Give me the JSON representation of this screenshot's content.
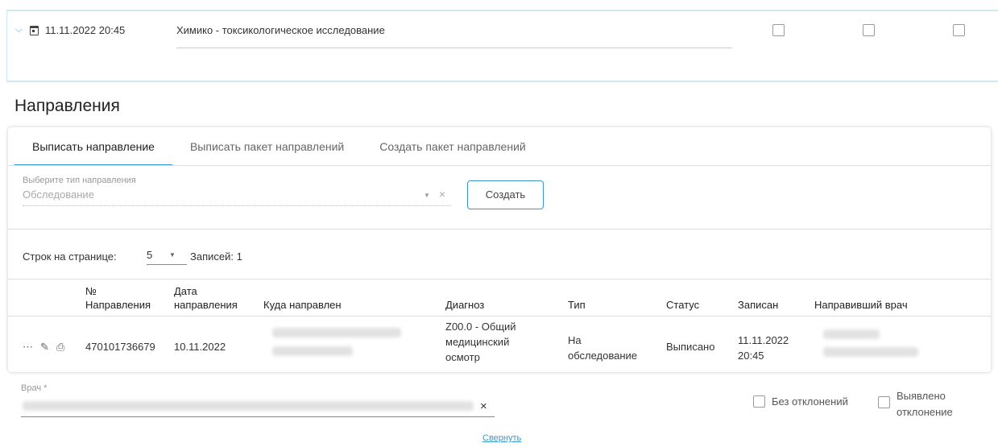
{
  "record": {
    "date": "11.11.2022 20:45",
    "name": "Химико - токсикологическое исследование"
  },
  "section_title": "Направления",
  "tabs": [
    {
      "label": "Выписать направление"
    },
    {
      "label": "Выписать пакет направлений"
    },
    {
      "label": "Создать пакет направлений"
    }
  ],
  "type_select": {
    "label": "Выберите тип направления",
    "value": "Обследование"
  },
  "create_button": "Создать",
  "pagination": {
    "rows_label": "Строк на странице:",
    "rows_value": "5",
    "records_label": "Записей: 1"
  },
  "table": {
    "headers": {
      "number": "№\nНаправления",
      "date": "Дата\nнаправления",
      "destination": "Куда направлен",
      "diagnosis": "Диагноз",
      "type": "Тип",
      "status": "Статус",
      "booked": "Записан",
      "doctor": "Направивший врач"
    },
    "row": {
      "number": "470101736679",
      "date": "10.11.2022",
      "diagnosis": "Z00.0 - Общий\nмедицинский\nосмотр",
      "type": "На\nобследование",
      "status": "Выписано",
      "booked": "11.11.2022\n20:45"
    }
  },
  "doctor_field": {
    "label": "Врач *"
  },
  "options": {
    "no_deviation": "Без отклонений",
    "deviation": "Выявлено\nотклонение"
  },
  "collapse_link": "Свернуть"
}
